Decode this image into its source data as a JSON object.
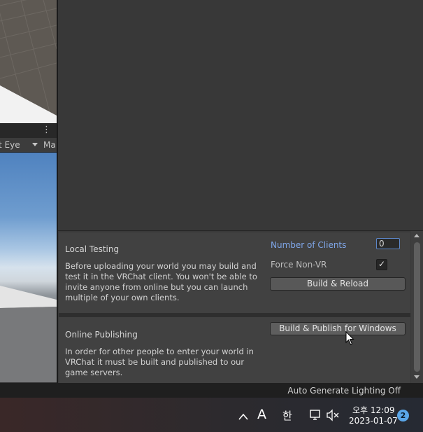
{
  "left_panel": {
    "menu_icon": "kebab-menu-icon",
    "eye_dropdown": "ft Eye",
    "ma_label": "Ma"
  },
  "local_testing": {
    "title": "Local Testing",
    "description": "Before uploading your world you may build and test it in the VRChat client. You won't be able to invite anyone from online but you can launch multiple of your own clients.",
    "number_of_clients_label": "Number of Clients",
    "number_of_clients_value": "0",
    "force_non_vr_label": "Force Non-VR",
    "force_non_vr_checked": true,
    "check_glyph": "✓",
    "build_reload_label": "Build & Reload"
  },
  "online_publishing": {
    "title": "Online Publishing",
    "description": "In order for other people to enter your world in VRChat it must be built and published to our game servers.",
    "build_publish_label": "Build & Publish for Windows"
  },
  "status_bar": {
    "text": "Auto Generate Lighting Off"
  },
  "taskbar": {
    "chevron_glyph": "^",
    "ime_glyph": "A",
    "hangul_glyph": "한",
    "time": "오후 12:09",
    "date": "2023-01-07",
    "notification_count": "2",
    "icons": [
      "chevron-up-icon",
      "ime-mode-icon",
      "hangul-icon",
      "network-icon",
      "volume-muted-icon",
      "notification-badge"
    ]
  },
  "colors": {
    "highlight_label": "#7fa6e8",
    "panel_bg": "#414141",
    "badge": "#5aa6e8"
  }
}
